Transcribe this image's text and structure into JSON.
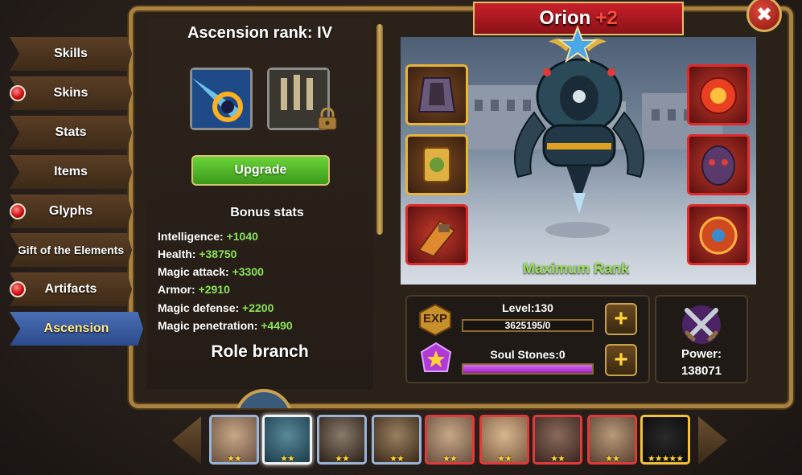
{
  "tabs": [
    {
      "label": "Skills",
      "dot": false
    },
    {
      "label": "Skins",
      "dot": true
    },
    {
      "label": "Stats",
      "dot": false
    },
    {
      "label": "Items",
      "dot": false
    },
    {
      "label": "Glyphs",
      "dot": true
    },
    {
      "label": "Gift of the Elements",
      "dot": false
    },
    {
      "label": "Artifacts",
      "dot": true
    },
    {
      "label": "Ascension",
      "dot": false,
      "active": true
    }
  ],
  "ascension": {
    "title": "Ascension rank: IV",
    "upgrade_label": "Upgrade",
    "bonus_title": "Bonus stats",
    "stats": [
      {
        "name": "Intelligence:",
        "value": "+1040"
      },
      {
        "name": "Health:",
        "value": "+38750"
      },
      {
        "name": "Magic attack:",
        "value": "+3300"
      },
      {
        "name": "Armor:",
        "value": "+2910"
      },
      {
        "name": "Magic defense:",
        "value": "+2200"
      },
      {
        "name": "Magic penetration:",
        "value": "+4490"
      }
    ],
    "role_branch": "Role branch"
  },
  "hero": {
    "name": "Orion",
    "plus": "+2",
    "rank_text": "Maximum Rank"
  },
  "progress": {
    "exp_icon": "EXP",
    "level_label": "Level:130",
    "exp_value": "3625195/0",
    "soul_label": "Soul Stones:0"
  },
  "power": {
    "label": "Power:",
    "value": "138071"
  },
  "colors": {
    "stat_value": "#8ce35a",
    "rank_text": "#9be05a",
    "hero_plus": "#ff4a3a",
    "active_tab": "#3a5ea0"
  }
}
